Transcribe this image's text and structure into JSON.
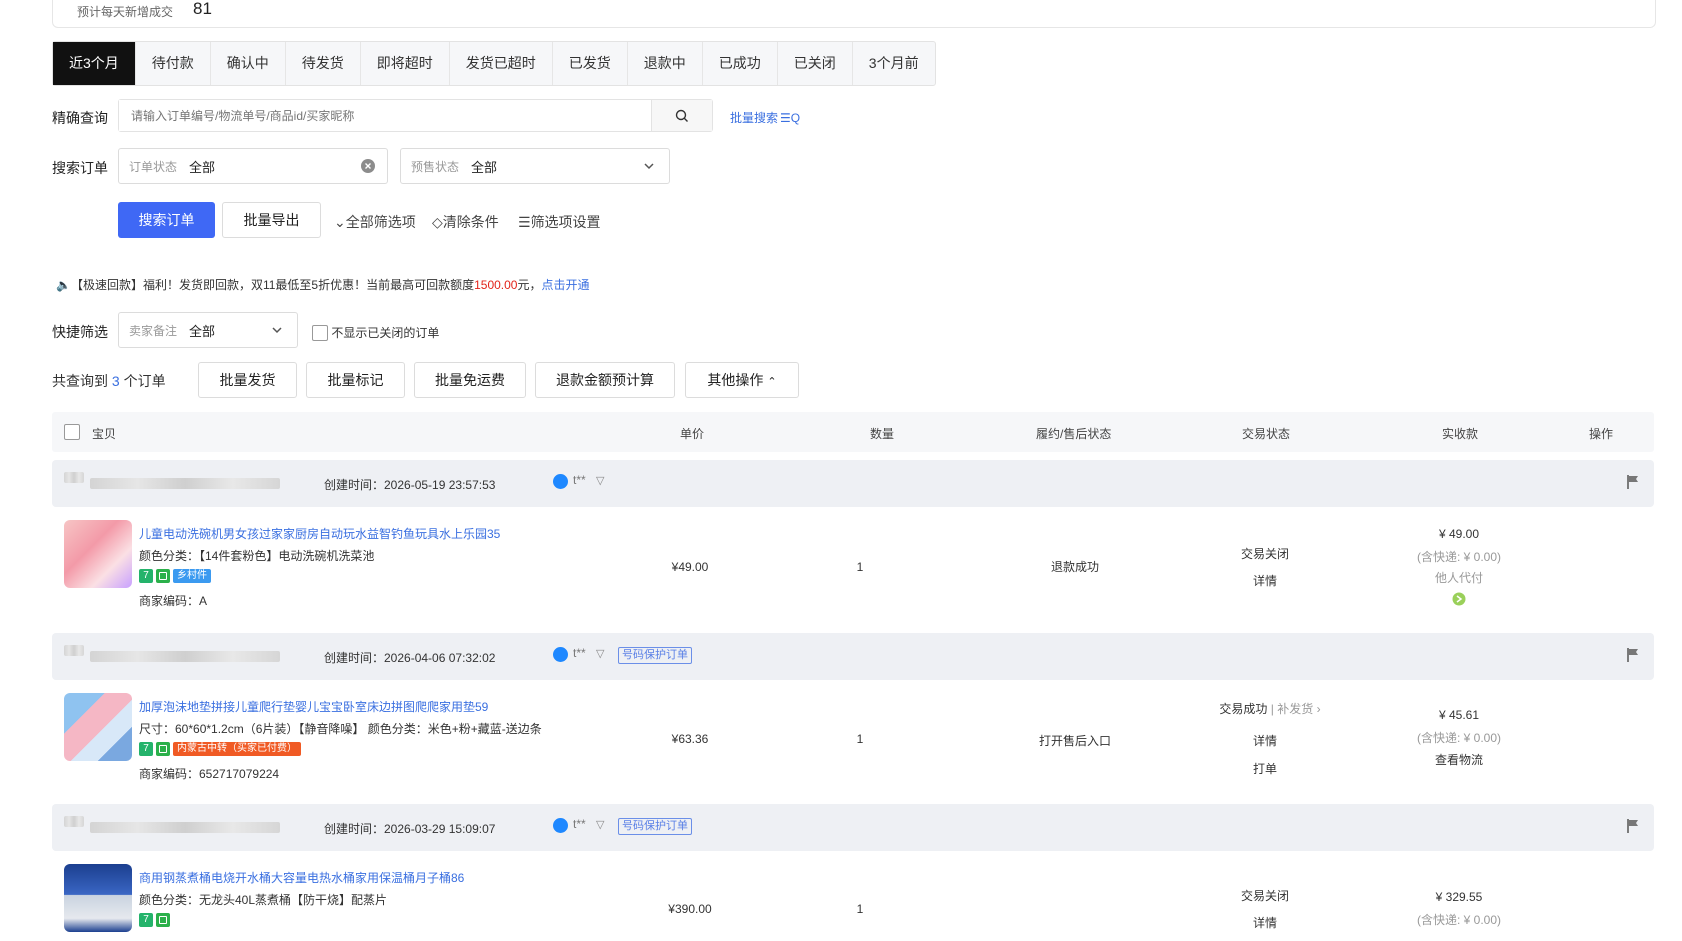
{
  "top": {
    "label": "预计每天新增成交",
    "value": "81"
  },
  "tabs": [
    "近3个月",
    "待付款",
    "确认中",
    "待发货",
    "即将超时",
    "发货已超时",
    "已发货",
    "退款中",
    "已成功",
    "已关闭",
    "3个月前"
  ],
  "query": {
    "label": "精确查询",
    "placeholder": "请输入订单编号/物流单号/商品id/买家昵称",
    "batch_search": "批量搜索"
  },
  "search": {
    "label": "搜索订单",
    "status_ph": "订单状态",
    "status_val": "全部",
    "presale_ph": "预售状态",
    "presale_val": "全部"
  },
  "actions": {
    "search": "搜索订单",
    "export": "批量导出",
    "all_filters": "全部筛选项",
    "clear": "清除条件",
    "filter_settings": "筛选项设置"
  },
  "notice": {
    "prefix": "【极速回款】福利！发货即回款，双11最低至5折优惠！当前最高可回款额度",
    "amount": "1500.00",
    "mid": "元，",
    "link": "点击开通"
  },
  "quick": {
    "label": "快捷筛选",
    "remark_ph": "卖家备注",
    "remark_val": "全部",
    "hide_closed": "不显示已关闭的订单"
  },
  "summary": {
    "prefix": "共查询到",
    "count": "3",
    "suffix": "个订单"
  },
  "bulk": {
    "ship": "批量发货",
    "mark": "批量标记",
    "free": "批量免运费",
    "refund": "退款金额预计算",
    "other": "其他操作"
  },
  "table_head": {
    "item": "宝贝",
    "price": "单价",
    "qty": "数量",
    "fulfill": "履约/售后状态",
    "trade": "交易状态",
    "paid": "实收款",
    "op": "操作"
  },
  "orders": [
    {
      "created": "创建时间：2026-05-19 23:57:53",
      "buyer": "t**",
      "title": "儿童电动洗碗机男女孩过家家厨房自动玩水益智钓鱼玩具水上乐园35",
      "spec": "颜色分类：【14件套粉色】电动洗碗机洗菜池",
      "tag": "乡村件",
      "code": "商家编码：A",
      "price": "¥49.00",
      "qty": "1",
      "fulfill": "退款成功",
      "trade": "交易关闭",
      "detail": "详情",
      "paid": "¥ 49.00",
      "shipping": "(含快递: ¥ 0.00)",
      "payer": "他人代付"
    },
    {
      "created": "创建时间：2026-04-06 07:32:02",
      "buyer": "t**",
      "protect": "号码保护订单",
      "title": "加厚泡沫地垫拼接儿童爬行垫婴儿宝宝卧室床边拼图爬爬家用垫59",
      "spec": "尺寸：60*60*1.2cm（6片装）【静音降噪】  颜色分类：米色+粉+藏蓝-送边条",
      "tag": "内蒙古中转（买家已付费）",
      "code": "商家编码：652717079224",
      "price": "¥63.36",
      "qty": "1",
      "fulfill": "打开售后入口",
      "trade": "交易成功",
      "extra": "补发货",
      "detail": "详情",
      "print": "打单",
      "paid": "¥ 45.61",
      "shipping": "(含快递: ¥ 0.00)",
      "logistics": "查看物流"
    },
    {
      "created": "创建时间：2026-03-29 15:09:07",
      "buyer": "t**",
      "protect": "号码保护订单",
      "title": "商用钢蒸煮桶电烧开水桶大容量电热水桶家用保温桶月子桶86",
      "spec": "颜色分类：无龙头40L蒸煮桶【防干烧】配蒸片",
      "price": "¥390.00",
      "qty": "1",
      "trade": "交易关闭",
      "detail": "详情",
      "paid": "¥ 329.55",
      "shipping": "(含快递: ¥ 0.00)"
    }
  ]
}
